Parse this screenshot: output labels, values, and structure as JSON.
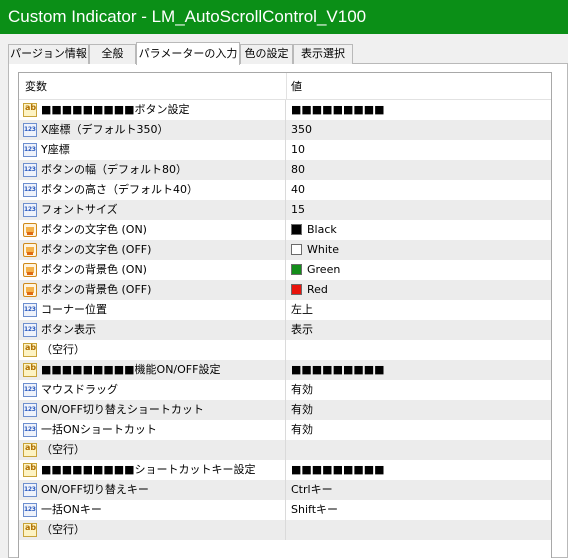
{
  "window": {
    "title": "Custom Indicator - LM_AutoScrollControl_V100"
  },
  "tabs": [
    {
      "label": "パージョン情報",
      "active": false
    },
    {
      "label": "全般",
      "active": false
    },
    {
      "label": "パラメーターの入力",
      "active": true
    },
    {
      "label": "色の設定",
      "active": false
    },
    {
      "label": "表示選択",
      "active": false
    }
  ],
  "grid": {
    "headers": {
      "variable": "変数",
      "value": "値"
    },
    "rows": [
      {
        "icon": "ab",
        "label": "■■■■■■■■■ボタン設定",
        "value": "■■■■■■■■■"
      },
      {
        "icon": "num",
        "label": "X座標（デフォルト350）",
        "value": "350"
      },
      {
        "icon": "num",
        "label": "Y座標",
        "value": "10"
      },
      {
        "icon": "num",
        "label": "ボタンの幅（デフォルト80）",
        "value": "80"
      },
      {
        "icon": "num",
        "label": "ボタンの高さ（デフォルト40）",
        "value": "40"
      },
      {
        "icon": "num",
        "label": "フォントサイズ",
        "value": "15"
      },
      {
        "icon": "color",
        "label": "ボタンの文字色 (ON)",
        "value": "Black",
        "swatch": "#000000"
      },
      {
        "icon": "color",
        "label": "ボタンの文字色 (OFF)",
        "value": "White",
        "swatch": "#ffffff"
      },
      {
        "icon": "color",
        "label": "ボタンの背景色 (ON)",
        "value": "Green",
        "swatch": "#138c1a"
      },
      {
        "icon": "color",
        "label": "ボタンの背景色 (OFF)",
        "value": "Red",
        "swatch": "#e8140c"
      },
      {
        "icon": "num",
        "label": "コーナー位置",
        "value": "左上"
      },
      {
        "icon": "num",
        "label": "ボタン表示",
        "value": "表示"
      },
      {
        "icon": "ab",
        "label": "（空行）",
        "value": ""
      },
      {
        "icon": "ab",
        "label": "■■■■■■■■■機能ON/OFF設定",
        "value": "■■■■■■■■■"
      },
      {
        "icon": "num",
        "label": "マウスドラッグ",
        "value": "有効"
      },
      {
        "icon": "num",
        "label": "ON/OFF切り替えショートカット",
        "value": "有効"
      },
      {
        "icon": "num",
        "label": "一括ONショートカット",
        "value": "有効"
      },
      {
        "icon": "ab",
        "label": "（空行）",
        "value": ""
      },
      {
        "icon": "ab",
        "label": "■■■■■■■■■ショートカットキー設定",
        "value": "■■■■■■■■■"
      },
      {
        "icon": "num",
        "label": "ON/OFF切り替えキー",
        "value": "Ctrlキー"
      },
      {
        "icon": "num",
        "label": "一括ONキー",
        "value": "Shiftキー"
      },
      {
        "icon": "ab",
        "label": "（空行）",
        "value": ""
      }
    ]
  }
}
